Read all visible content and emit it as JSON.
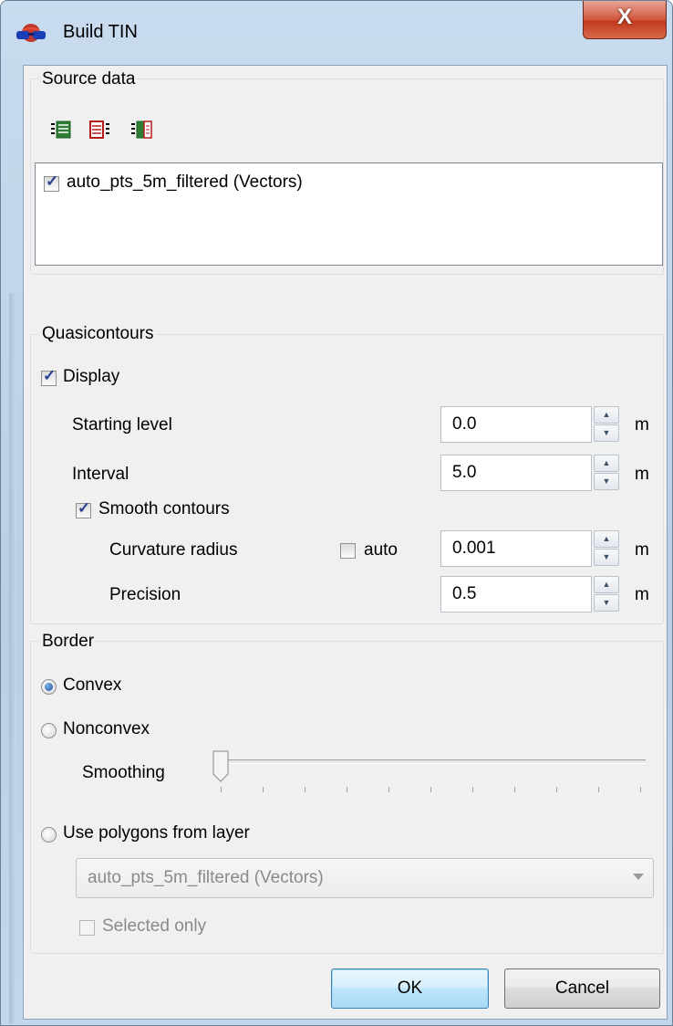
{
  "window": {
    "title": "Build TIN",
    "close_glyph": "X",
    "icon": "globe-3d-glasses-icon"
  },
  "source_data": {
    "title": "Source data",
    "toolbar_icons": [
      "select-all-icon",
      "deselect-all-icon",
      "invert-selection-icon"
    ],
    "layers": [
      {
        "label": "auto_pts_5m_filtered (Vectors)",
        "checked": true
      }
    ]
  },
  "quasicontours": {
    "title": "Quasicontours",
    "display_label": "Display",
    "display_checked": true,
    "starting_level": {
      "label": "Starting level",
      "value": "0.0",
      "unit": "m"
    },
    "interval": {
      "label": "Interval",
      "value": "5.0",
      "unit": "m"
    },
    "smooth_contours_label": "Smooth contours",
    "smooth_contours_checked": true,
    "curvature_radius": {
      "label": "Curvature radius",
      "auto_label": "auto",
      "auto_checked": false,
      "value": "0.001",
      "unit": "m"
    },
    "precision": {
      "label": "Precision",
      "value": "0.5",
      "unit": "m"
    }
  },
  "border": {
    "title": "Border",
    "options": {
      "convex": "Convex",
      "nonconvex": "Nonconvex",
      "use_polygons": "Use polygons from layer"
    },
    "selected": "convex",
    "smoothing_label": "Smoothing",
    "smoothing_value": 0,
    "layer_combo_value": "auto_pts_5m_filtered (Vectors)",
    "selected_only_label": "Selected only",
    "selected_only_checked": false
  },
  "buttons": {
    "ok": "OK",
    "cancel": "Cancel"
  },
  "colors": {
    "accent": "#2b3f8f",
    "title_bar": "#c8dbef",
    "close_button": "#c23a20",
    "panel_bg": "#f0f0f0"
  }
}
